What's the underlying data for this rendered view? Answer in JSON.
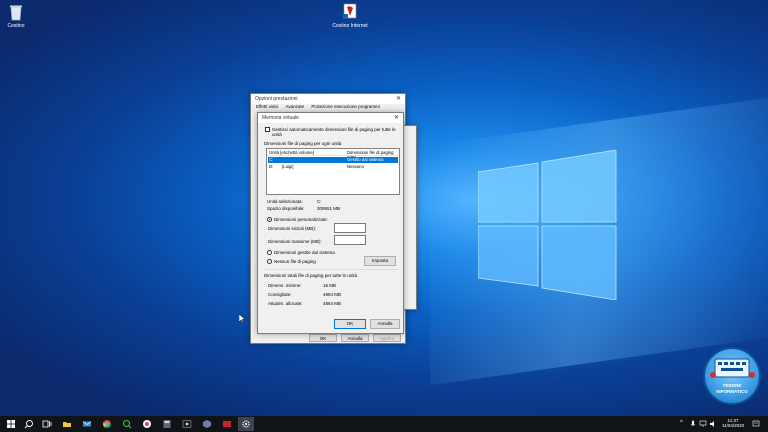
{
  "desktop": {
    "icons": [
      {
        "label": "Cestino"
      },
      {
        "label": "Cestino Internet"
      }
    ]
  },
  "back_window": {
    "title": "Opzioni prestazioni",
    "tabs": [
      "Effetti visivi",
      "Avanzate",
      "Protezione esecuzione programmi"
    ],
    "ok_label": "OK",
    "cancel_label": "Annulla",
    "apply_label": "Applica"
  },
  "dialog": {
    "title": "Memoria virtuale",
    "auto_manage_label": "Gestisci automaticamente dimensioni file di paging per tutte le unità",
    "section_label": "Dimensioni file di paging per ogni unità",
    "col_drive": "Unità [etichetta volume]",
    "col_size": "Dimensioni file di paging (MB)",
    "drives": [
      {
        "drive": "C:",
        "label": "",
        "size": "Gestito dal sistema"
      },
      {
        "drive": "D:",
        "label": "[Luigi]",
        "size": "Nessuno"
      }
    ],
    "selected_drive_label": "Unità selezionata:",
    "selected_drive_value": "C:",
    "space_label": "Spazio disponibile:",
    "space_value": "309551 MB",
    "custom_size_label": "Dimensioni personalizzate:",
    "initial_size_label": "Dimensioni iniziali (MB):",
    "initial_size_value": "",
    "max_size_label": "Dimensioni massime (MB):",
    "max_size_value": "",
    "system_managed_label": "Dimensioni gestite dal sistema",
    "no_paging_label": "Nessun file di paging",
    "set_button": "Imposta",
    "totals_label": "Dimensioni totali file di paging per tutte le unità",
    "min_label": "Dimens. minime:",
    "min_value": "16 MB",
    "recommended_label": "Consigliate:",
    "recommended_value": "4984 MB",
    "allocated_label": "Attualm. allocate:",
    "allocated_value": "4864 MB",
    "ok_label": "OK",
    "cancel_label": "Annulla"
  },
  "taskbar": {
    "time": "11:37",
    "date": "11/04/2020"
  },
  "badge": {
    "line1": "TENORE",
    "line2": "INFORMATICO"
  },
  "colors": {
    "accent": "#0078d7",
    "taskbar": "#101418"
  }
}
